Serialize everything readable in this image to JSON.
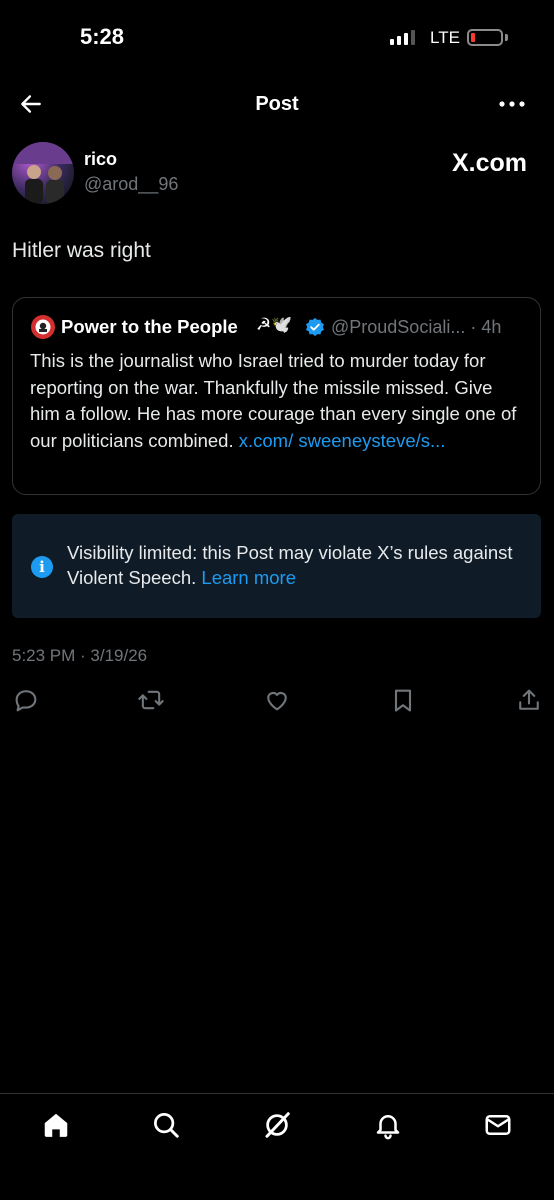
{
  "status_bar": {
    "time": "5:28",
    "network": "LTE"
  },
  "header": {
    "title": "Post"
  },
  "author": {
    "name": "rico",
    "handle": "@arod__96",
    "badge": "X.com"
  },
  "post": {
    "text": "Hitler was right",
    "timestamp": "5:23 PM · 3/19/26"
  },
  "quote": {
    "name": "Power to the People",
    "emoji": "☭🕊️",
    "handle": "@ProudSociali... · 4h",
    "body": "This is the journalist who Israel tried to murder today for reporting on the war. Thankfully the missile missed. Give him a follow. He has more courage than every single one of our politicians combined. ",
    "link": "x.com/ sweeneysteve/s..."
  },
  "notice": {
    "text": "Visibility limited: this Post may violate X’s rules against Violent Speech. ",
    "link": "Learn more"
  },
  "colors": {
    "accent": "#1d9bf0",
    "muted": "#71767b",
    "notice_bg": "#0f1c28",
    "battery_low": "#ff3b30"
  },
  "icons": {
    "actions": [
      "reply-icon",
      "repost-icon",
      "like-icon",
      "bookmark-icon",
      "share-icon"
    ],
    "nav": [
      "home-icon",
      "search-icon",
      "grok-icon",
      "notifications-icon",
      "messages-icon"
    ]
  }
}
